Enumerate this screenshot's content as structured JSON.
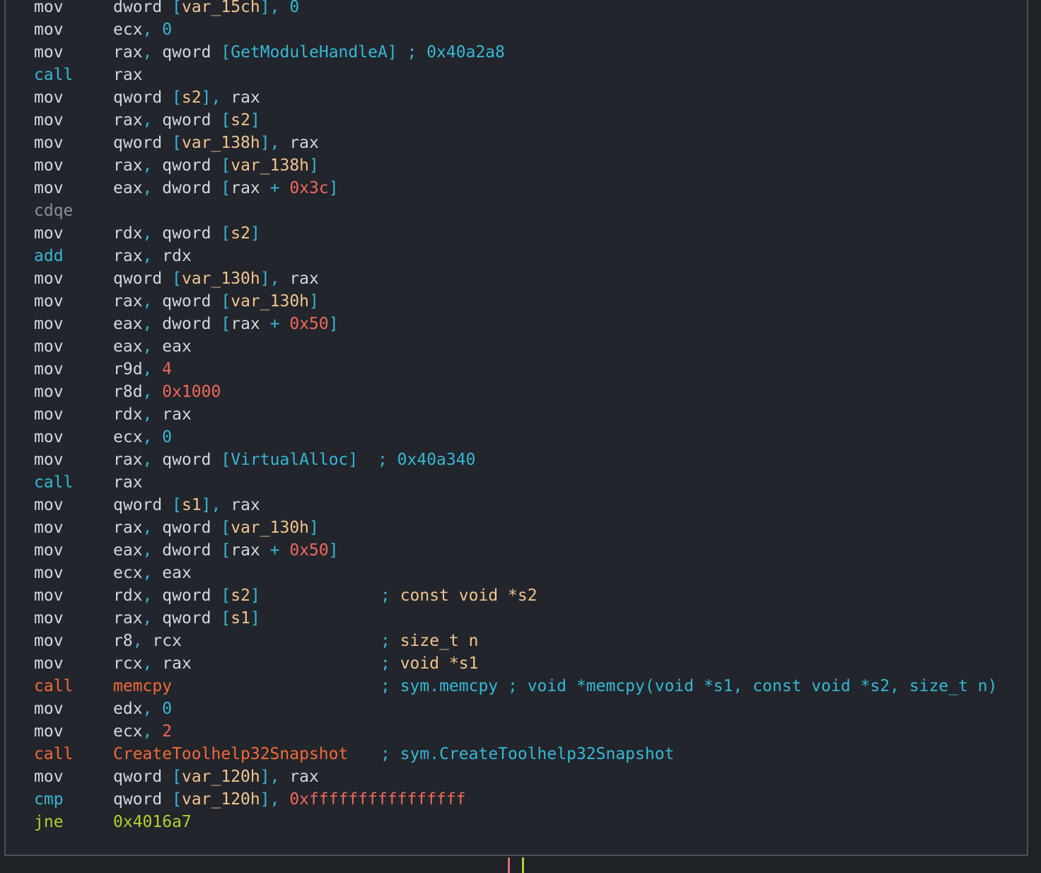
{
  "disassembly": {
    "lines": [
      {
        "mn": "mov",
        "op": "dword [var_15ch], 0",
        "cm": ""
      },
      {
        "mn": "mov",
        "op": "ecx, 0",
        "cm": ""
      },
      {
        "mn": "mov",
        "op": "rax, qword [GetModuleHandleA] ; 0x40a2a8",
        "cm": ""
      },
      {
        "mn": "call",
        "op": "rax",
        "cm": ""
      },
      {
        "mn": "mov",
        "op": "qword [s2], rax",
        "cm": ""
      },
      {
        "mn": "mov",
        "op": "rax, qword [s2]",
        "cm": ""
      },
      {
        "mn": "mov",
        "op": "qword [var_138h], rax",
        "cm": ""
      },
      {
        "mn": "mov",
        "op": "rax, qword [var_138h]",
        "cm": ""
      },
      {
        "mn": "mov",
        "op": "eax, dword [rax + 0x3c]",
        "cm": ""
      },
      {
        "mn": "cdqe",
        "op": "",
        "cm": ""
      },
      {
        "mn": "mov",
        "op": "rdx, qword [s2]",
        "cm": ""
      },
      {
        "mn": "add",
        "op": "rax, rdx",
        "cm": ""
      },
      {
        "mn": "mov",
        "op": "qword [var_130h], rax",
        "cm": ""
      },
      {
        "mn": "mov",
        "op": "rax, qword [var_130h]",
        "cm": ""
      },
      {
        "mn": "mov",
        "op": "eax, dword [rax + 0x50]",
        "cm": ""
      },
      {
        "mn": "mov",
        "op": "eax, eax",
        "cm": ""
      },
      {
        "mn": "mov",
        "op": "r9d, 4",
        "cm": ""
      },
      {
        "mn": "mov",
        "op": "r8d, 0x1000",
        "cm": ""
      },
      {
        "mn": "mov",
        "op": "rdx, rax",
        "cm": ""
      },
      {
        "mn": "mov",
        "op": "ecx, 0",
        "cm": ""
      },
      {
        "mn": "mov",
        "op": "rax, qword [VirtualAlloc]  ; 0x40a340",
        "cm": ""
      },
      {
        "mn": "call",
        "op": "rax",
        "cm": ""
      },
      {
        "mn": "mov",
        "op": "qword [s1], rax",
        "cm": ""
      },
      {
        "mn": "mov",
        "op": "rax, qword [var_130h]",
        "cm": ""
      },
      {
        "mn": "mov",
        "op": "eax, dword [rax + 0x50]",
        "cm": ""
      },
      {
        "mn": "mov",
        "op": "ecx, eax",
        "cm": ""
      },
      {
        "mn": "mov",
        "op": "rdx, qword [s2]",
        "cm": "; const void *s2"
      },
      {
        "mn": "mov",
        "op": "rax, qword [s1]",
        "cm": ""
      },
      {
        "mn": "mov",
        "op": "r8, rcx",
        "cm": "; size_t n"
      },
      {
        "mn": "mov",
        "op": "rcx, rax",
        "cm": "; void *s1"
      },
      {
        "mn": "call",
        "op": "memcpy",
        "cm": "; sym.memcpy ; void *memcpy(void *s1, const void *s2, size_t n)"
      },
      {
        "mn": "mov",
        "op": "edx, 0",
        "cm": ""
      },
      {
        "mn": "mov",
        "op": "ecx, 2",
        "cm": ""
      },
      {
        "mn": "call",
        "op": "CreateToolhelp32Snapshot",
        "cm": "; sym.CreateToolhelp32Snapshot"
      },
      {
        "mn": "mov",
        "op": "qword [var_120h], rax",
        "cm": ""
      },
      {
        "mn": "cmp",
        "op": "qword [var_120h], 0xffffffffffffffff",
        "cm": ""
      },
      {
        "mn": "jne",
        "op": "0x4016a7",
        "cm": ""
      }
    ]
  },
  "colors": {
    "background": "#1e2126",
    "node_background": "#22252b",
    "node_border": "#4c5058",
    "call": "#35b8d6",
    "call_symbol": "#f26a38",
    "jump": "#b4cf2e",
    "number": "#f0685a",
    "memory_var": "#f2c48e",
    "marker_true": "#b4cf2e",
    "marker_false": "#e06b74"
  }
}
